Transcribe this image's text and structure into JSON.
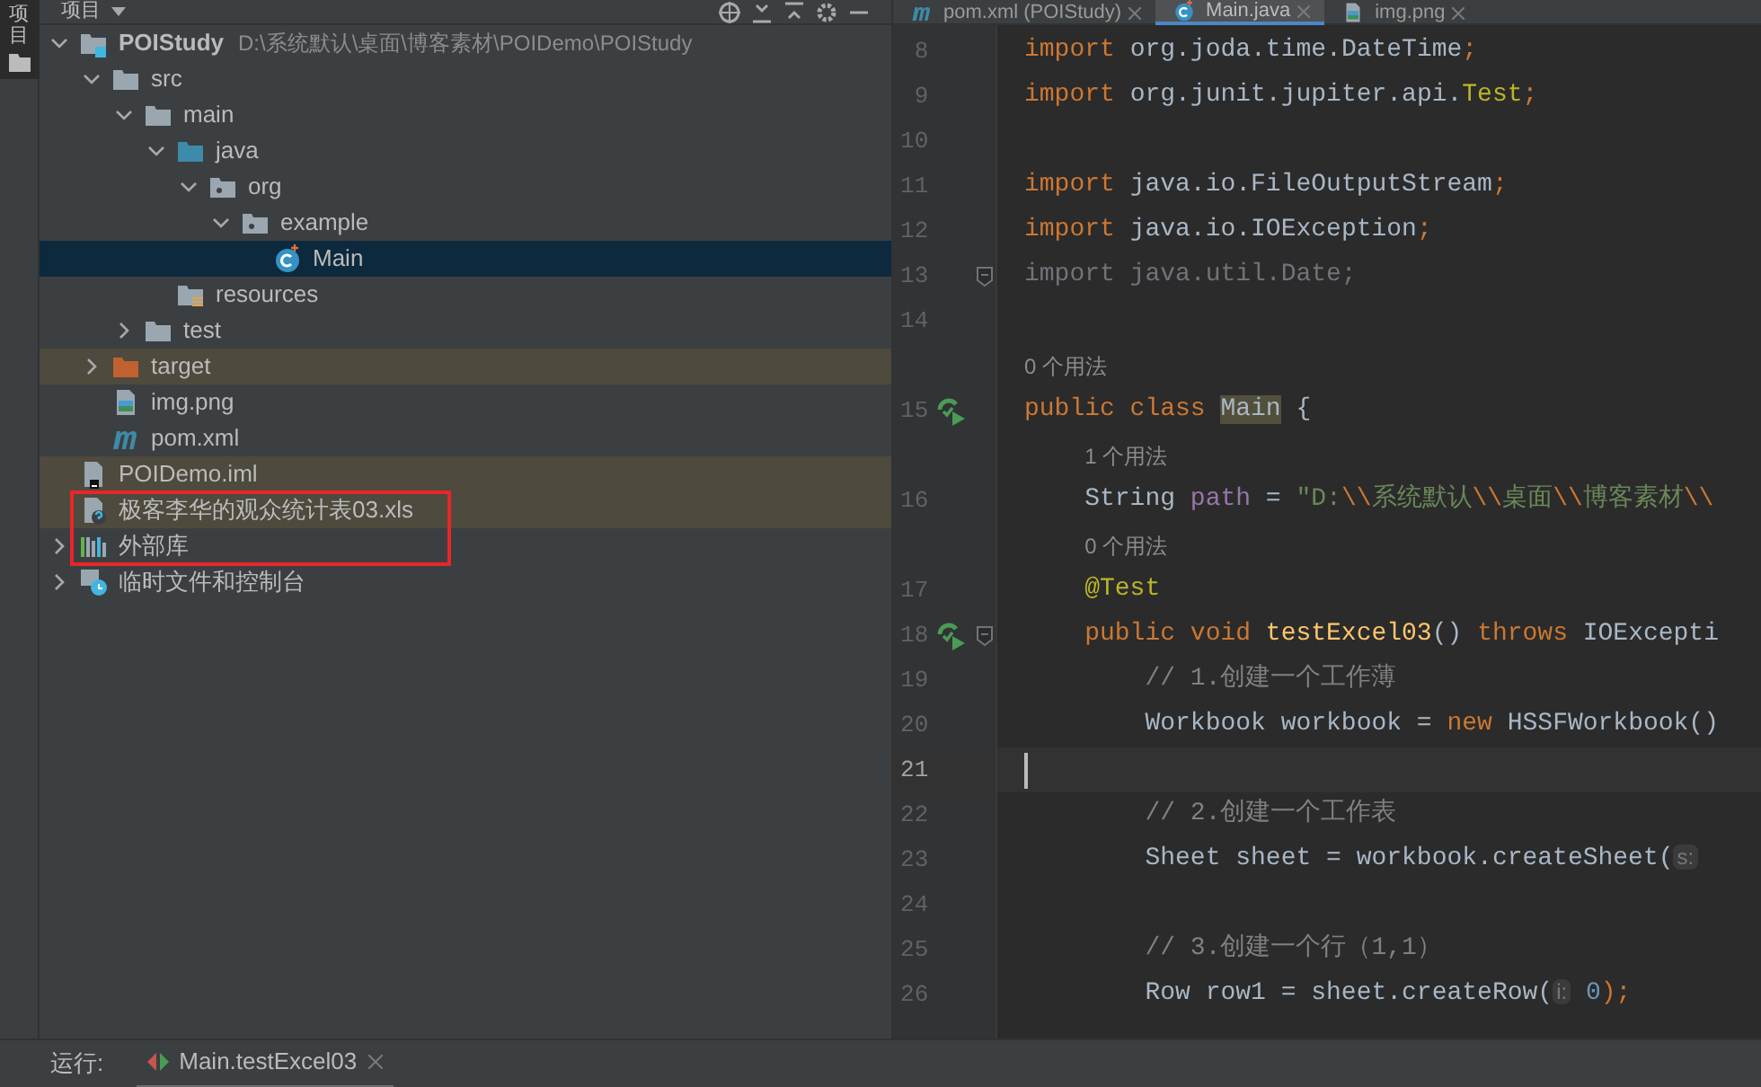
{
  "tool_strip": {
    "label": "项目",
    "selected": true
  },
  "project_header": {
    "title": "项目"
  },
  "tree": [
    {
      "label": "POIStudy",
      "kind": "project",
      "path": "D:\\系统默认\\桌面\\博客素材\\POIDemo\\POIStudy",
      "expanded": true,
      "selected": false,
      "ignored": false,
      "children": [
        {
          "label": "src",
          "kind": "folder",
          "expanded": true,
          "selected": false,
          "ignored": false,
          "children": [
            {
              "label": "main",
              "kind": "folder",
              "expanded": true,
              "selected": false,
              "ignored": false,
              "children": [
                {
                  "label": "java",
                  "kind": "source",
                  "expanded": true,
                  "selected": false,
                  "ignored": false,
                  "children": [
                    {
                      "label": "org",
                      "kind": "package",
                      "expanded": true,
                      "selected": false,
                      "ignored": false,
                      "children": [
                        {
                          "label": "example",
                          "kind": "package",
                          "expanded": true,
                          "selected": false,
                          "ignored": false,
                          "children": [
                            {
                              "label": "Main",
                              "kind": "class",
                              "selected": true,
                              "ignored": false
                            }
                          ]
                        }
                      ]
                    }
                  ]
                },
                {
                  "label": "resources",
                  "kind": "resources",
                  "selected": false,
                  "ignored": false
                }
              ]
            },
            {
              "label": "test",
              "kind": "folder",
              "expanded": false,
              "selected": false,
              "ignored": false
            }
          ]
        },
        {
          "label": "target",
          "kind": "target",
          "expanded": false,
          "selected": false,
          "ignored": true
        },
        {
          "label": "img.png",
          "kind": "image",
          "selected": false,
          "ignored": false
        },
        {
          "label": "pom.xml",
          "kind": "maven",
          "selected": false,
          "ignored": false
        }
      ]
    },
    {
      "label": "POIDemo.iml",
      "kind": "iml",
      "selected": false,
      "ignored": true
    },
    {
      "label": "极客李华的观众统计表03.xls",
      "kind": "unknown",
      "selected": false,
      "ignored": true
    },
    {
      "label": "外部库",
      "kind": "libraries",
      "expanded": false,
      "selected": false,
      "ignored": false
    },
    {
      "label": "临时文件和控制台",
      "kind": "scratches",
      "expanded": false,
      "selected": false,
      "ignored": false
    }
  ],
  "editor_tabs": [
    {
      "label": "pom.xml (POIStudy)",
      "kind": "maven",
      "selected": false
    },
    {
      "label": "Main.java",
      "kind": "class",
      "selected": true
    },
    {
      "label": "img.png",
      "kind": "image",
      "selected": false
    }
  ],
  "code": [
    {
      "number": "8",
      "tokens": [
        {
          "kind": "kw",
          "text": "import"
        },
        {
          "kind": "plain",
          "text": " org.joda.time.DateTime"
        },
        {
          "kind": "kw",
          "text": ";"
        }
      ]
    },
    {
      "number": "9",
      "tokens": [
        {
          "kind": "kw",
          "text": "import"
        },
        {
          "kind": "plain",
          "text": " org.junit.jupiter.api."
        },
        {
          "kind": "annot",
          "text": "Test"
        },
        {
          "kind": "kw",
          "text": ";"
        }
      ]
    },
    {
      "number": "10"
    },
    {
      "number": "11",
      "tokens": [
        {
          "kind": "kw",
          "text": "import"
        },
        {
          "kind": "plain",
          "text": " java.io.FileOutputStream"
        },
        {
          "kind": "kw",
          "text": ";"
        }
      ]
    },
    {
      "number": "12",
      "tokens": [
        {
          "kind": "kw",
          "text": "import"
        },
        {
          "kind": "plain",
          "text": " java.io.IOException"
        },
        {
          "kind": "kw",
          "text": ";"
        }
      ]
    },
    {
      "number": "13",
      "fold": true,
      "tokens": [
        {
          "kind": "dim",
          "text": "import java.util.Date;"
        }
      ]
    },
    {
      "number": "14"
    },
    {
      "usages": "0 个用法"
    },
    {
      "number": "15",
      "run": true,
      "tokens": [
        {
          "kind": "kw",
          "text": "public class "
        },
        {
          "kind": "mark",
          "text": "Main"
        },
        {
          "kind": "plain",
          "text": " {"
        }
      ]
    },
    {
      "usages": "    1 个用法"
    },
    {
      "number": "16",
      "tokens": [
        {
          "kind": "plain",
          "text": "    String "
        },
        {
          "kind": "field",
          "text": "path"
        },
        {
          "kind": "plain",
          "text": " = "
        },
        {
          "kind": "str",
          "text": "\"D:"
        },
        {
          "kind": "kw",
          "text": "\\\\"
        },
        {
          "kind": "str",
          "text": "系统默认"
        },
        {
          "kind": "kw",
          "text": "\\\\"
        },
        {
          "kind": "str",
          "text": "桌面"
        },
        {
          "kind": "kw",
          "text": "\\\\"
        },
        {
          "kind": "str",
          "text": "博客素材"
        },
        {
          "kind": "kw",
          "text": "\\\\"
        }
      ]
    },
    {
      "usages": "    0 个用法"
    },
    {
      "number": "17",
      "tokens": [
        {
          "kind": "annot",
          "text": "    @Test"
        }
      ]
    },
    {
      "number": "18",
      "run": true,
      "fold": true,
      "tokens": [
        {
          "kind": "kw",
          "text": "    public void "
        },
        {
          "kind": "fn",
          "text": "testExcel03"
        },
        {
          "kind": "plain",
          "text": "() "
        },
        {
          "kind": "kw",
          "text": "throws "
        },
        {
          "kind": "plain",
          "text": "IOExcepti"
        }
      ]
    },
    {
      "number": "19",
      "tokens": [
        {
          "kind": "comment",
          "text": "        // 1.创建一个工作薄"
        }
      ]
    },
    {
      "number": "20",
      "tokens": [
        {
          "kind": "plain",
          "text": "        Workbook workbook = "
        },
        {
          "kind": "kw",
          "text": "new "
        },
        {
          "kind": "plain",
          "text": "HSSFWorkbook()"
        }
      ]
    },
    {
      "number": "21",
      "current": true
    },
    {
      "number": "22",
      "tokens": [
        {
          "kind": "comment",
          "text": "        // 2.创建一个工作表"
        }
      ]
    },
    {
      "number": "23",
      "tokens": [
        {
          "kind": "plain",
          "text": "        Sheet sheet = workbook.createSheet("
        },
        {
          "kind": "hint",
          "text": "s:"
        }
      ]
    },
    {
      "number": "24"
    },
    {
      "number": "25",
      "tokens": [
        {
          "kind": "comment",
          "text": "        // 3.创建一个行（1,1）"
        }
      ]
    },
    {
      "number": "26",
      "tokens": [
        {
          "kind": "plain",
          "text": "        Row row1 = sheet.createRow("
        },
        {
          "kind": "hint",
          "text": "i:"
        },
        {
          "kind": "num",
          "text": " 0"
        },
        {
          "kind": "kw",
          "text": ");"
        }
      ]
    }
  ],
  "run_bar": {
    "label": "运行:",
    "tabs": [
      {
        "label": "Main.testExcel03",
        "selected": true
      }
    ]
  }
}
